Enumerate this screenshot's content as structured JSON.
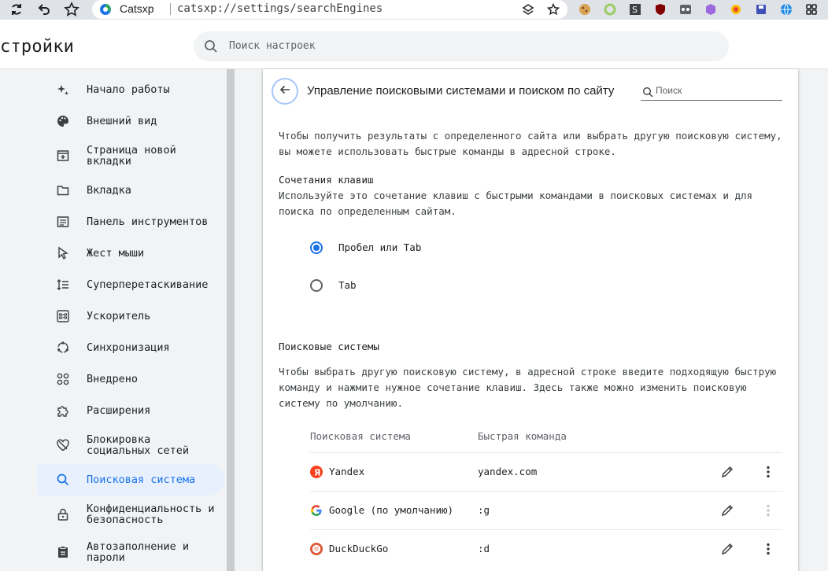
{
  "browser": {
    "host": "Catsxp",
    "url": "catsxp://settings/searchEngines"
  },
  "header": {
    "title": "стройки",
    "search_placeholder": "Поиск настроек"
  },
  "sidebar": {
    "items": [
      {
        "label": "Начало работы",
        "icon": "sparkle-icon"
      },
      {
        "label": "Внешний вид",
        "icon": "palette-icon"
      },
      {
        "label": "Страница новой\nвкладки",
        "icon": "new-tab-icon"
      },
      {
        "label": "Вкладка",
        "icon": "folder-tab-icon"
      },
      {
        "label": "Панель инструментов",
        "icon": "toolbar-icon"
      },
      {
        "label": "Жест мыши",
        "icon": "cursor-icon"
      },
      {
        "label": "Суперперетаскивание",
        "icon": "drag-icon"
      },
      {
        "label": "Ускоритель",
        "icon": "command-icon"
      },
      {
        "label": "Синхронизация",
        "icon": "sync-icon"
      },
      {
        "label": "Внедрено",
        "icon": "apps-icon"
      },
      {
        "label": "Расширения",
        "icon": "puzzle-icon"
      },
      {
        "label": "Блокировка\nсоциальных сетей",
        "icon": "heart-block-icon"
      },
      {
        "label": "Поисковая система",
        "icon": "search-icon",
        "active": true
      },
      {
        "label": "Конфиденциальность и\nбезопасность",
        "icon": "lock-icon"
      },
      {
        "label": "Автозаполнение и\nпароли",
        "icon": "clipboard-icon"
      }
    ]
  },
  "main": {
    "title": "Управление поисковыми системами и поиском по сайту",
    "search_placeholder": "Поиск",
    "intro": "Чтобы получить результаты с определенного сайта или выбрать другую поисковую систему, вы можете использовать быстрые команды в адресной строке.",
    "shortcut_title": "Сочетания клавиш",
    "shortcut_desc": "Используйте это сочетание клавиш с быстрыми командами в поисковых системах и для поиска по определенным сайтам.",
    "radio_options": [
      {
        "label": "Пробел или Tab",
        "checked": true
      },
      {
        "label": "Tab",
        "checked": false
      }
    ],
    "engines_title": "Поисковые системы",
    "engines_desc": "Чтобы выбрать другую поисковую систему, в адресной строке введите подходящую быструю команду и нажмите нужное сочетание клавиш. Здесь также можно изменить поисковую систему по умолчанию.",
    "columns": {
      "engine": "Поисковая система",
      "keyword": "Быстрая команда"
    },
    "engines": [
      {
        "name": "Yandex",
        "keyword": "yandex.com",
        "icon": "yandex-icon"
      },
      {
        "name": "Google (по умолчанию)",
        "keyword": ":g",
        "icon": "google-icon",
        "more_disabled": true
      },
      {
        "name": "DuckDuckGo",
        "keyword": ":d",
        "icon": "duckduckgo-icon"
      }
    ]
  },
  "colors": {
    "accent": "#1a73e8",
    "active_bg": "#e8f0fe"
  }
}
